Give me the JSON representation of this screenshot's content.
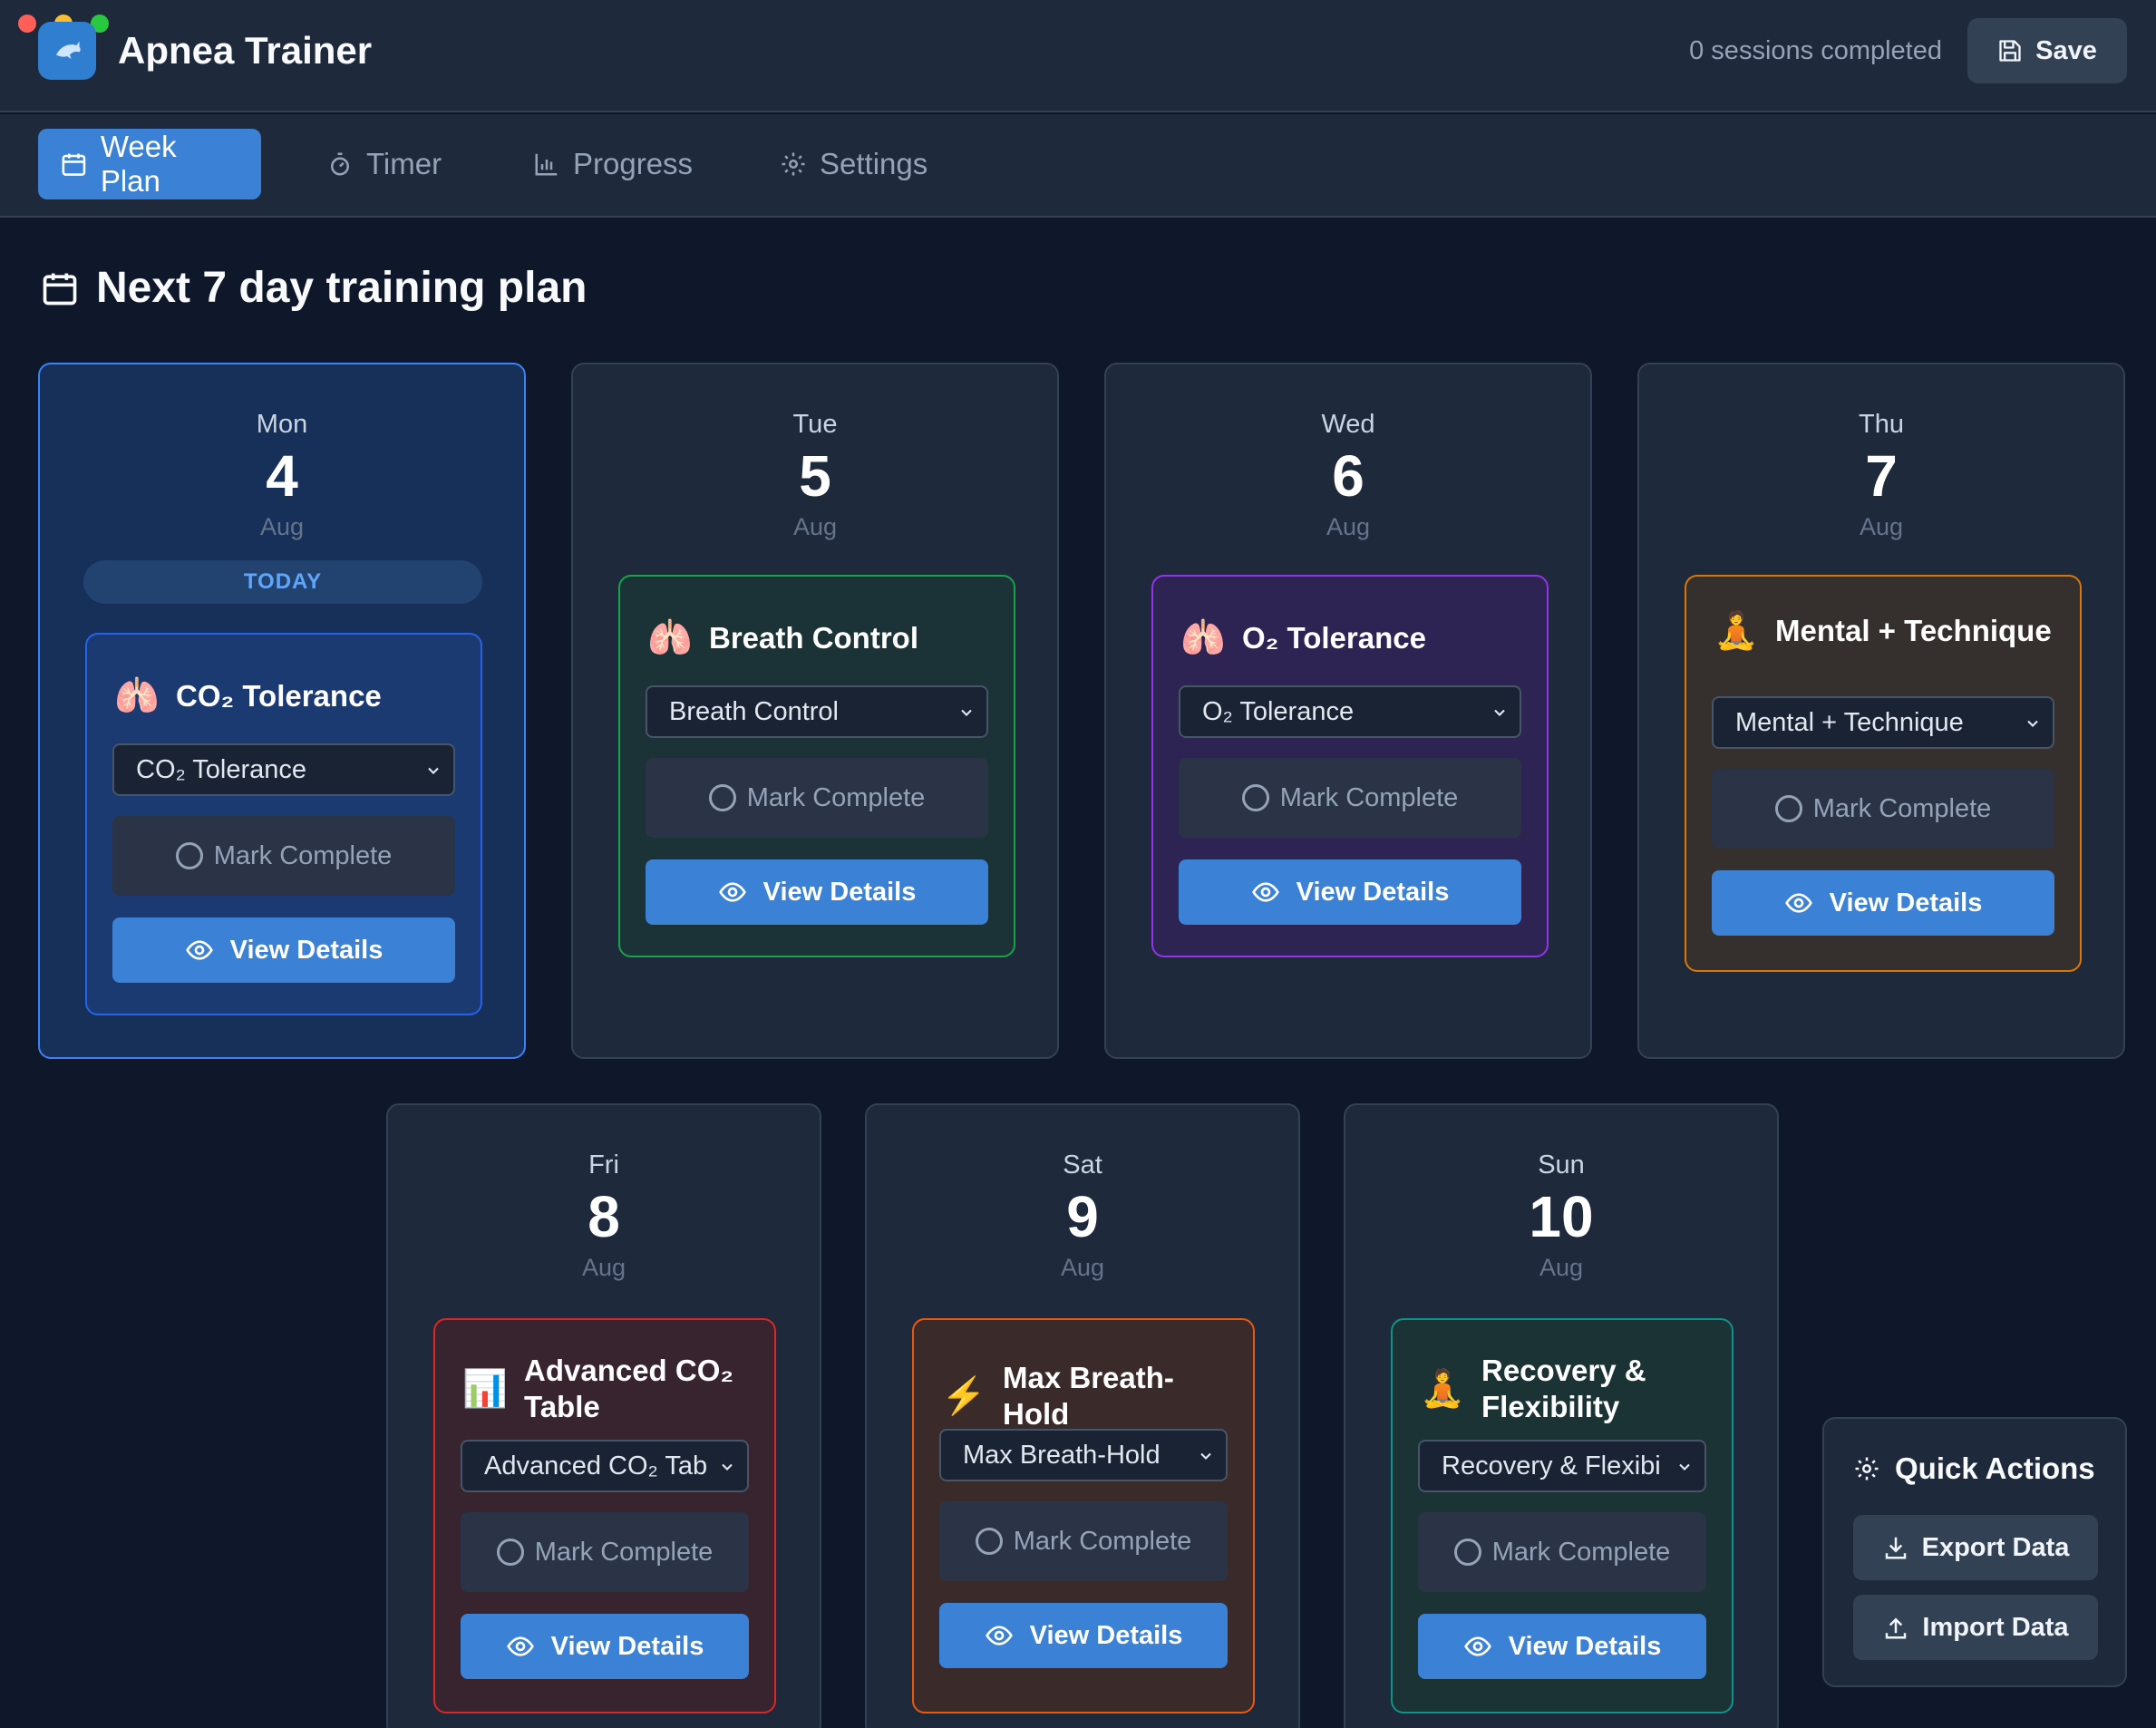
{
  "app": {
    "title": "Apnea Trainer",
    "logo_icon": "dolphin-icon",
    "sessions_text": "0 sessions completed",
    "save_label": "Save"
  },
  "tabs": [
    {
      "label": "Week Plan",
      "icon": "calendar-icon",
      "active": true
    },
    {
      "label": "Timer",
      "icon": "stopwatch-icon",
      "active": false
    },
    {
      "label": "Progress",
      "icon": "bar-chart-icon",
      "active": false
    },
    {
      "label": "Settings",
      "icon": "gear-icon",
      "active": false
    }
  ],
  "page": {
    "heading": "Next 7 day training plan"
  },
  "days": [
    {
      "day": "Mon",
      "date": "4",
      "month": "Aug",
      "today_badge": "TODAY",
      "session": {
        "title": "CO₂ Tolerance",
        "icon": "🫁",
        "select_value": "CO₂ Tolerance",
        "mark_label": "Mark Complete",
        "view_label": "View Details",
        "accent": "#2563eb"
      }
    },
    {
      "day": "Tue",
      "date": "5",
      "month": "Aug",
      "session": {
        "title": "Breath Control",
        "icon": "🫁",
        "select_value": "Breath Control",
        "mark_label": "Mark Complete",
        "view_label": "View Details",
        "accent": "#16a34a"
      }
    },
    {
      "day": "Wed",
      "date": "6",
      "month": "Aug",
      "session": {
        "title": "O₂ Tolerance",
        "icon": "🫁",
        "select_value": "O₂ Tolerance",
        "mark_label": "Mark Complete",
        "view_label": "View Details",
        "accent": "#9333ea"
      }
    },
    {
      "day": "Thu",
      "date": "7",
      "month": "Aug",
      "session": {
        "title": "Mental + Technique",
        "icon": "🧘",
        "select_value": "Mental + Technique",
        "mark_label": "Mark Complete",
        "view_label": "View Details",
        "accent": "#d97706"
      }
    },
    {
      "day": "Fri",
      "date": "8",
      "month": "Aug",
      "session": {
        "title": "Advanced CO₂ Table",
        "icon": "📊",
        "select_value": "Advanced CO₂ Tab",
        "mark_label": "Mark Complete",
        "view_label": "View Details",
        "accent": "#dc2626"
      }
    },
    {
      "day": "Sat",
      "date": "9",
      "month": "Aug",
      "session": {
        "title": "Max Breath-Hold",
        "icon": "⚡",
        "select_value": "Max Breath-Hold",
        "mark_label": "Mark Complete",
        "view_label": "View Details",
        "accent": "#ea580c"
      }
    },
    {
      "day": "Sun",
      "date": "10",
      "month": "Aug",
      "session": {
        "title": "Recovery & Flexibility",
        "icon": "🧘",
        "select_value": "Recovery & Flexibi",
        "mark_label": "Mark Complete",
        "view_label": "View Details",
        "accent": "#0d9488"
      }
    }
  ],
  "quick_actions": {
    "title": "Quick Actions",
    "export_label": "Export Data",
    "import_label": "Import Data"
  },
  "colors": {
    "primary": "#3b82d6",
    "background": "#0f172a",
    "panel": "#1e293b"
  }
}
